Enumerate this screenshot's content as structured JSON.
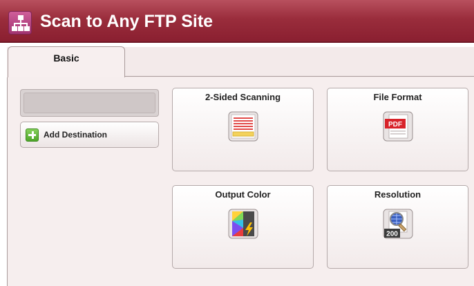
{
  "window": {
    "title": "Scan to Any FTP Site",
    "icon": "network-icon"
  },
  "tabs": [
    {
      "label": "Basic",
      "selected": true
    }
  ],
  "destination": {
    "value": "",
    "add_button_label": "Add Destination",
    "add_icon": "plus-icon"
  },
  "functions": [
    {
      "label": "2-Sided Scanning",
      "icon": "two-sided-document-icon"
    },
    {
      "label": "File Format",
      "icon": "pdf-file-icon",
      "badge": "PDF"
    },
    {
      "label": "Output Color",
      "icon": "color-palette-icon"
    },
    {
      "label": "Resolution",
      "icon": "resolution-magnifier-icon",
      "badge": "200"
    }
  ],
  "colors": {
    "title_bar": "#9a2d3c",
    "panel_background": "#f6eeee",
    "add_icon": "#4ea52a",
    "pdf_badge": "#d8232a"
  }
}
